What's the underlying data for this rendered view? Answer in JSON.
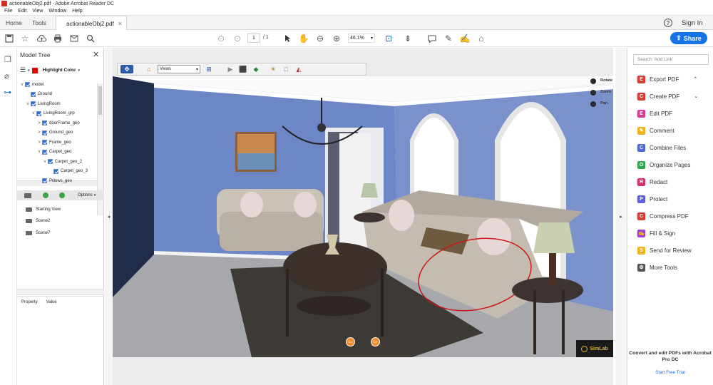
{
  "window": {
    "title": "actionableObj2.pdf - Adobe Acrobat Reader DC"
  },
  "menu": [
    "File",
    "Edit",
    "View",
    "Window",
    "Help"
  ],
  "tabs": {
    "home": "Home",
    "tools": "Tools",
    "doc": "actionableObj2.pdf",
    "doc_close": "×"
  },
  "header": {
    "help": "?",
    "signin": "Sign In"
  },
  "toolbar": {
    "page_current": "1",
    "page_total": "/ 1",
    "zoom": "46.1%",
    "share": "Share"
  },
  "model_tree": {
    "title": "Model Tree",
    "close": "✕",
    "highlight_label": "Highlight Color",
    "nodes": [
      {
        "label": "model",
        "level": 0,
        "expand": "v"
      },
      {
        "label": "Ground",
        "level": 1,
        "expand": ""
      },
      {
        "label": "LivingRoom",
        "level": 1,
        "expand": "v"
      },
      {
        "label": "LivingRoom_grp",
        "level": 2,
        "expand": "v"
      },
      {
        "label": "doorFrame_geo",
        "level": 3,
        "expand": ">"
      },
      {
        "label": "Ground_geo",
        "level": 3,
        "expand": ">"
      },
      {
        "label": "Frame_geo",
        "level": 3,
        "expand": ">"
      },
      {
        "label": "Carpet_geo",
        "level": 3,
        "expand": "v"
      },
      {
        "label": "Carpet_geo_2",
        "level": 4,
        "expand": "v"
      },
      {
        "label": "Carpet_geo_3",
        "level": 5,
        "expand": ""
      },
      {
        "label": "Pillows_geo",
        "level": 3,
        "expand": ""
      }
    ],
    "options_label": "Options",
    "views": [
      "Starting View",
      "Scene2",
      "Scene7"
    ],
    "property_col": "Property",
    "value_col": "Value"
  },
  "viewer3d": {
    "views_select": "Views",
    "legend": [
      "Rotate",
      "Zoom",
      "Pan"
    ],
    "logo": "SimLab"
  },
  "tools_panel": {
    "search_placeholder": "Search 'Add Link'",
    "items": [
      {
        "label": "Export PDF",
        "color": "#d83b2f",
        "icon": "E",
        "chevron": "⌃"
      },
      {
        "label": "Create PDF",
        "color": "#d83b2f",
        "icon": "C",
        "chevron": "⌄"
      },
      {
        "label": "Edit PDF",
        "color": "#d83b8f",
        "icon": "E"
      },
      {
        "label": "Comment",
        "color": "#f0b21e",
        "icon": "✎"
      },
      {
        "label": "Combine Files",
        "color": "#4b68d6",
        "icon": "C"
      },
      {
        "label": "Organize Pages",
        "color": "#2fa84f",
        "icon": "O"
      },
      {
        "label": "Redact",
        "color": "#d8306f",
        "icon": "R"
      },
      {
        "label": "Protect",
        "color": "#5b5ee0",
        "icon": "P"
      },
      {
        "label": "Compress PDF",
        "color": "#d83b2f",
        "icon": "C"
      },
      {
        "label": "Fill & Sign",
        "color": "#a63bd8",
        "icon": "✍"
      },
      {
        "label": "Send for Review",
        "color": "#f0b21e",
        "icon": "S"
      },
      {
        "label": "More Tools",
        "color": "#555555",
        "icon": "⚙"
      }
    ],
    "promo": "Convert and edit PDFs with Acrobat Pro DC",
    "trial": "Start Free Trial"
  }
}
